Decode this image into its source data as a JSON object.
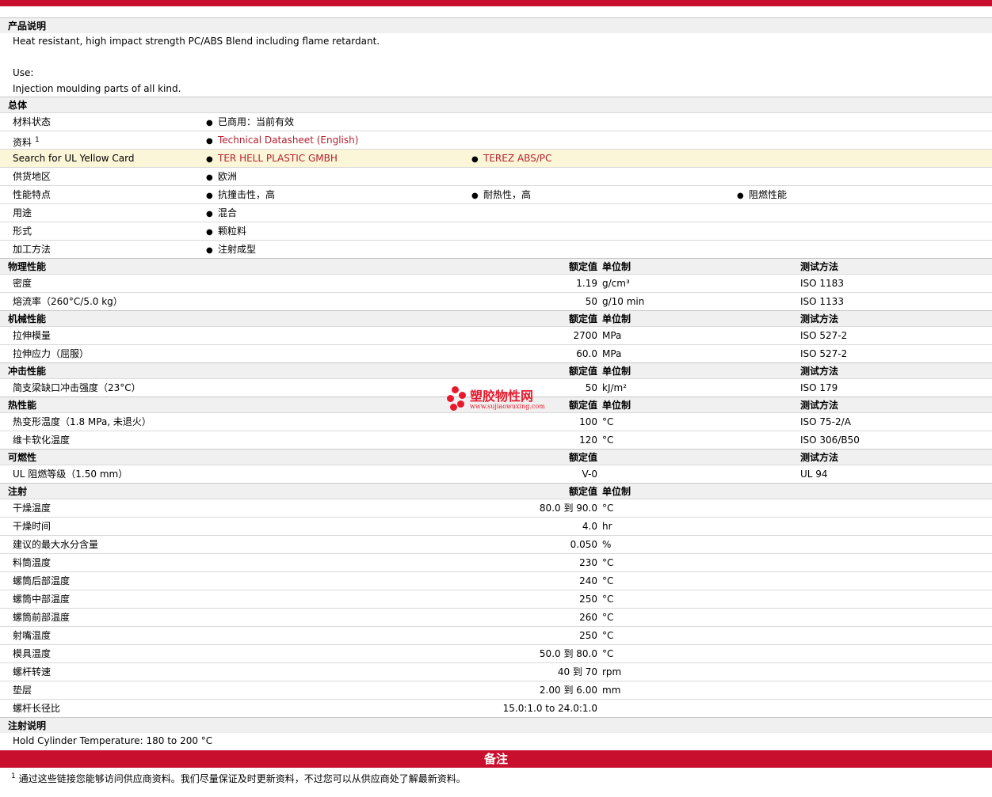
{
  "colors": {
    "brand_red": "#c8102e",
    "link_red": "#b5202e",
    "highlight": "#fbf6d8"
  },
  "product": {
    "title": "产品说明",
    "lines": [
      "Heat resistant, high impact strength PC/ABS Blend including flame retardant.",
      "",
      "Use:",
      "Injection moulding parts of all kind."
    ]
  },
  "general": {
    "title": "总体",
    "rows": [
      {
        "label": "材料状态",
        "items": [
          "已商用：当前有效"
        ]
      },
      {
        "label": "资料",
        "sup": "1",
        "links": [
          "Technical Datasheet (English)"
        ]
      },
      {
        "label": "Search for UL Yellow Card",
        "links": [
          "TER HELL PLASTIC GMBH",
          "TEREZ ABS/PC"
        ]
      },
      {
        "label": "供货地区",
        "items": [
          "欧洲"
        ]
      },
      {
        "label": "性能特点",
        "items": [
          "抗撞击性，高",
          "耐热性，高",
          "阻燃性能"
        ]
      },
      {
        "label": "用途",
        "items": [
          "混合"
        ]
      },
      {
        "label": "形式",
        "items": [
          "颗粒料"
        ]
      },
      {
        "label": "加工方法",
        "items": [
          "注射成型"
        ]
      }
    ]
  },
  "col": {
    "value": "额定值",
    "unit": "单位制",
    "method": "测试方法"
  },
  "sections": [
    {
      "title": "物理性能",
      "unit_col": true,
      "method_col": true,
      "rows": [
        {
          "label": "密度",
          "value": "1.19",
          "unit": "g/cm³",
          "method": "ISO 1183"
        },
        {
          "label": "熔流率（260°C/5.0 kg）",
          "value": "50",
          "unit": "g/10 min",
          "method": "ISO 1133"
        }
      ]
    },
    {
      "title": "机械性能",
      "unit_col": true,
      "method_col": true,
      "rows": [
        {
          "label": "拉伸模量",
          "value": "2700",
          "unit": "MPa",
          "method": "ISO 527-2"
        },
        {
          "label": "拉伸应力（屈服）",
          "value": "60.0",
          "unit": "MPa",
          "method": "ISO 527-2"
        }
      ]
    },
    {
      "title": "冲击性能",
      "unit_col": true,
      "method_col": true,
      "rows": [
        {
          "label": "简支梁缺口冲击强度（23°C）",
          "value": "50",
          "unit": "kJ/m²",
          "method": "ISO 179"
        }
      ]
    },
    {
      "title": "热性能",
      "unit_col": true,
      "method_col": true,
      "rows": [
        {
          "label": "热变形温度（1.8 MPa, 未退火）",
          "value": "100",
          "unit": "°C",
          "method": "ISO 75-2/A"
        },
        {
          "label": "维卡软化温度",
          "value": "120",
          "unit": "°C",
          "method": "ISO 306/B50"
        }
      ]
    },
    {
      "title": "可燃性",
      "unit_col": false,
      "method_col": true,
      "rows": [
        {
          "label": "UL 阻燃等级（1.50 mm）",
          "value": "V-0",
          "unit": "",
          "method": "UL 94"
        }
      ]
    },
    {
      "title": "注射",
      "unit_col": true,
      "method_col": false,
      "rows": [
        {
          "label": "干燥温度",
          "value": "80.0 到 90.0",
          "unit": "°C",
          "method": ""
        },
        {
          "label": "干燥时间",
          "value": "4.0",
          "unit": "hr",
          "method": ""
        },
        {
          "label": "建议的最大水分含量",
          "value": "0.050",
          "unit": "%",
          "method": ""
        },
        {
          "label": "料筒温度",
          "value": "230",
          "unit": "°C",
          "method": ""
        },
        {
          "label": "螺筒后部温度",
          "value": "240",
          "unit": "°C",
          "method": ""
        },
        {
          "label": "螺筒中部温度",
          "value": "250",
          "unit": "°C",
          "method": ""
        },
        {
          "label": "螺筒前部温度",
          "value": "260",
          "unit": "°C",
          "method": ""
        },
        {
          "label": "射嘴温度",
          "value": "250",
          "unit": "°C",
          "method": ""
        },
        {
          "label": "模具温度",
          "value": "50.0 到 80.0",
          "unit": "°C",
          "method": ""
        },
        {
          "label": "螺杆转速",
          "value": "40 到 70",
          "unit": "rpm",
          "method": ""
        },
        {
          "label": "垫层",
          "value": "2.00 到 6.00",
          "unit": "mm",
          "method": ""
        },
        {
          "label": "螺杆长径比",
          "value": "15.0:1.0 to 24.0:1.0",
          "unit": "",
          "method": ""
        }
      ]
    }
  ],
  "injection_notes": {
    "title": "注射说明",
    "text": "Hold Cylinder Temperature: 180 to 200 °C"
  },
  "notes": {
    "title": "备注",
    "footnote_mark": "1",
    "footnote": "通过这些链接您能够访问供应商资料。我们尽量保证及时更新资料，不过您可以从供应商处了解最新资料。"
  },
  "watermark": {
    "name": "塑胶物性网",
    "url": "www.sujiaowuxing.com"
  }
}
